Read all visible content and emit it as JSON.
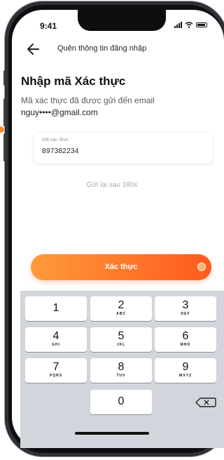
{
  "status_bar": {
    "time": "9:41"
  },
  "header": {
    "back_icon": "arrow-left-icon",
    "title": "Quên thông tin đăng nhập"
  },
  "page": {
    "title": "Nhập mã Xác thực",
    "description": "Mã xác thực đã được gửi đến email",
    "email": "nguy••••@gmail.com"
  },
  "code_input": {
    "label": "Mã xác thực",
    "value": "897382234"
  },
  "resend": {
    "text": "Gửi lại sau 180s"
  },
  "verify_button": {
    "label": "Xác thực"
  },
  "keypad": {
    "keys": [
      {
        "num": "1",
        "letters": ""
      },
      {
        "num": "2",
        "letters": "ABC"
      },
      {
        "num": "3",
        "letters": "DEF"
      },
      {
        "num": "4",
        "letters": "GHI"
      },
      {
        "num": "5",
        "letters": "JKL"
      },
      {
        "num": "6",
        "letters": "MNO"
      },
      {
        "num": "7",
        "letters": "PQRS"
      },
      {
        "num": "8",
        "letters": "TUV"
      },
      {
        "num": "9",
        "letters": "WXYZ"
      },
      {
        "num": "0",
        "letters": ""
      }
    ],
    "delete_icon": "backspace-icon"
  },
  "colors": {
    "accent_start": "#ff9a3a",
    "accent_end": "#ff5a1f"
  }
}
